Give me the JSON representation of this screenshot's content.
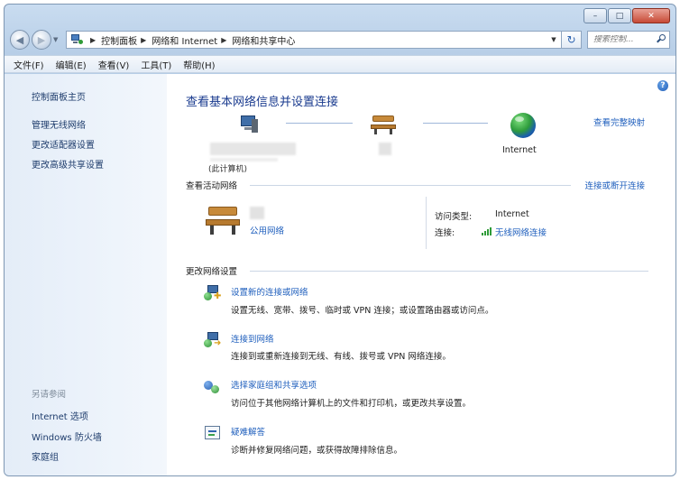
{
  "window": {
    "caption_buttons": [
      "–",
      "□",
      "✕"
    ]
  },
  "address": {
    "breadcrumbs": [
      "控制面板",
      "网络和 Internet",
      "网络和共享中心"
    ],
    "search_placeholder": "搜索控制..."
  },
  "menu": [
    "文件(F)",
    "编辑(E)",
    "查看(V)",
    "工具(T)",
    "帮助(H)"
  ],
  "sidebar": {
    "home": "控制面板主页",
    "links": [
      "管理无线网络",
      "更改适配器设置",
      "更改高级共享设置"
    ],
    "see_also_title": "另请参阅",
    "see_also": [
      "Internet 选项",
      "Windows 防火墙",
      "家庭组"
    ]
  },
  "main": {
    "title": "查看基本网络信息并设置连接",
    "view_full_map": "查看完整映射",
    "map": {
      "computer_caption": "(此计算机)",
      "internet_label": "Internet"
    },
    "active_networks": {
      "title": "查看活动网络",
      "connect_disconnect": "连接或断开连接",
      "network_type": "公用网络",
      "access_type_label": "访问类型:",
      "access_type_value": "Internet",
      "connection_label": "连接:",
      "connection_value": "无线网络连接"
    },
    "change_settings": {
      "title": "更改网络设置",
      "tasks": [
        {
          "title": "设置新的连接或网络",
          "desc": "设置无线、宽带、拨号、临时或 VPN 连接；或设置路由器或访问点。"
        },
        {
          "title": "连接到网络",
          "desc": "连接到或重新连接到无线、有线、拨号或 VPN 网络连接。"
        },
        {
          "title": "选择家庭组和共享选项",
          "desc": "访问位于其他网络计算机上的文件和打印机，或更改共享设置。"
        },
        {
          "title": "疑难解答",
          "desc": "诊断并修复网络问题，或获得故障排除信息。"
        }
      ]
    }
  },
  "colors": {
    "link": "#1f5fbd",
    "title": "#1a3b8f",
    "sidebar_bg": "#e4edf8"
  }
}
